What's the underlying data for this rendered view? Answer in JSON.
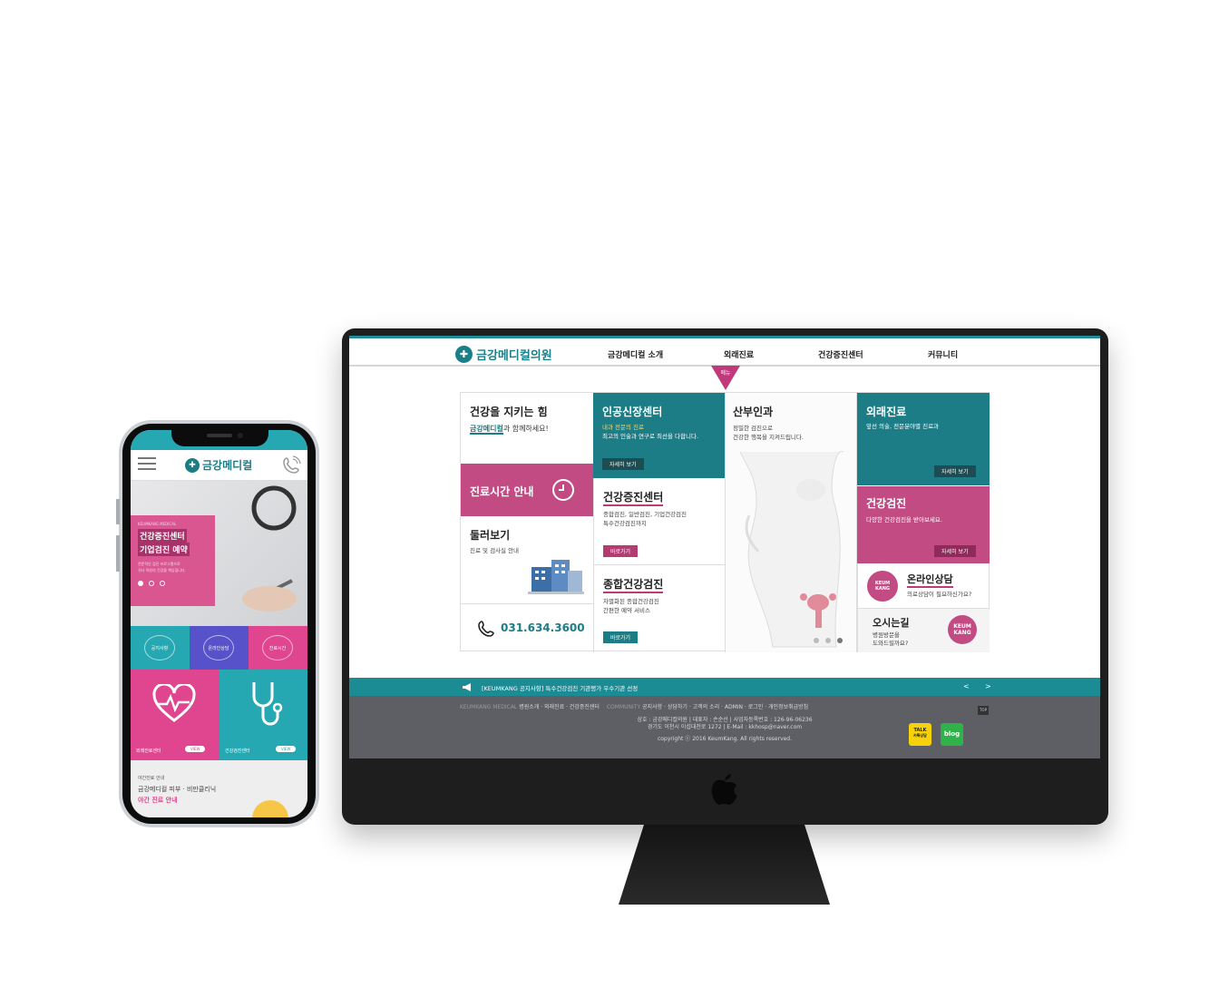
{
  "desktop": {
    "logo": "금강메디컬의원",
    "nav": [
      "금강메디컬 소개",
      "외래진료",
      "건강증진센터",
      "커뮤니티"
    ],
    "menu_tab": "메뉴",
    "col1": {
      "title": "건강을 지키는 힘",
      "tag_brand": "금강메디컬",
      "tag_rest": "과 함께하세요!",
      "hours": "진료시간 안내",
      "tour_title": "둘러보기",
      "tour_sub": "진료 및 검사실 안내",
      "phone": "031.634.3600"
    },
    "col2": {
      "kidney_title": "인공신장센터",
      "kidney_hl": "내과 전문의 진료",
      "kidney_sub": "최고의 인술과 연구로 최선을 다합니다.",
      "kidney_btn": "자세히 보기",
      "health_title": "건강증진센터",
      "health_sub1": "종합검진, 일반검진, 기업건강검진",
      "health_sub2": "특수건강검진까지",
      "health_btn": "바로가기",
      "comp_title": "종합건강검진",
      "comp_sub1": "차별화된 종합건강검진",
      "comp_sub2": "간편한 예약 서비스",
      "comp_btn": "바로가기"
    },
    "col3": {
      "title": "산부인과",
      "sub1": "정밀한 검진으로",
      "sub2": "건강한 행복을 지켜드립니다."
    },
    "col4": {
      "out_title": "외래진료",
      "out_sub": "앞선 의술, 전문분야별 진료과",
      "out_btn": "자세히 보기",
      "check_title": "건강검진",
      "check_sub": "다양한 건강검진을 받아보세요.",
      "check_btn": "자세히 보기",
      "online_title": "온라인상담",
      "online_sub": "의료상담이 필요하신가요?",
      "keum_badge": "KEUM KANG",
      "map_title": "오시는길",
      "map_sub1": "병원방문을",
      "map_sub2": "도와드릴까요?",
      "map_badge": "KEUM KANG"
    },
    "notice": "[KEUMKANG 공지사항]  특수건강검진 기관평가 우수기관 선정",
    "notice_prev": "<",
    "notice_next": ">",
    "footer": {
      "brand": "KEUMKANG MEDICAL",
      "links1": "병원소개 · 외래진료 · 건강증진센터",
      "community": "COMMUNITY",
      "links2": "공지사항 · 상담하기 · 고객의 소리 · ADMIN · 로그인 · 개인정보취급방침",
      "line1": "상호 : 금강메디컬의원  |  대표자 : 손순선  |  사업자등록번호 : 126-96-06236",
      "line2": "경기도 이천시 이섭대천로 1272  |  E-Mail : kkhosp@naver.com",
      "copyright": "copyright ⓒ 2016 KeumKang. All rights reserved.",
      "top": "TOP",
      "talk": "TALK",
      "talk_sub": "카톡상담",
      "blog": "blog"
    }
  },
  "mobile": {
    "logo": "금강메디컬",
    "hero_small": "KEUMKANG MEDICAL",
    "hero_line1": "건강증진센터",
    "hero_line2": "기업검진 예약",
    "hero_desc1": "전문적인 검진 프로그램으로",
    "hero_desc2": "귀사 직원의 건강을 책임집니다.",
    "quick": [
      "공지사항",
      "온라인상담",
      "진료시간"
    ],
    "card1_label": "외래진료센터",
    "card2_label": "건강검진센터",
    "card_btn": "VIEW",
    "night_small": "야간진료 안내",
    "night_line1": "금강메디컬 피부 · 비만클리닉",
    "night_line2": "야간 진료 안내"
  },
  "colors": {
    "teal": "#1c7d87",
    "pink": "#c34b84",
    "footer": "#5e5f64"
  }
}
